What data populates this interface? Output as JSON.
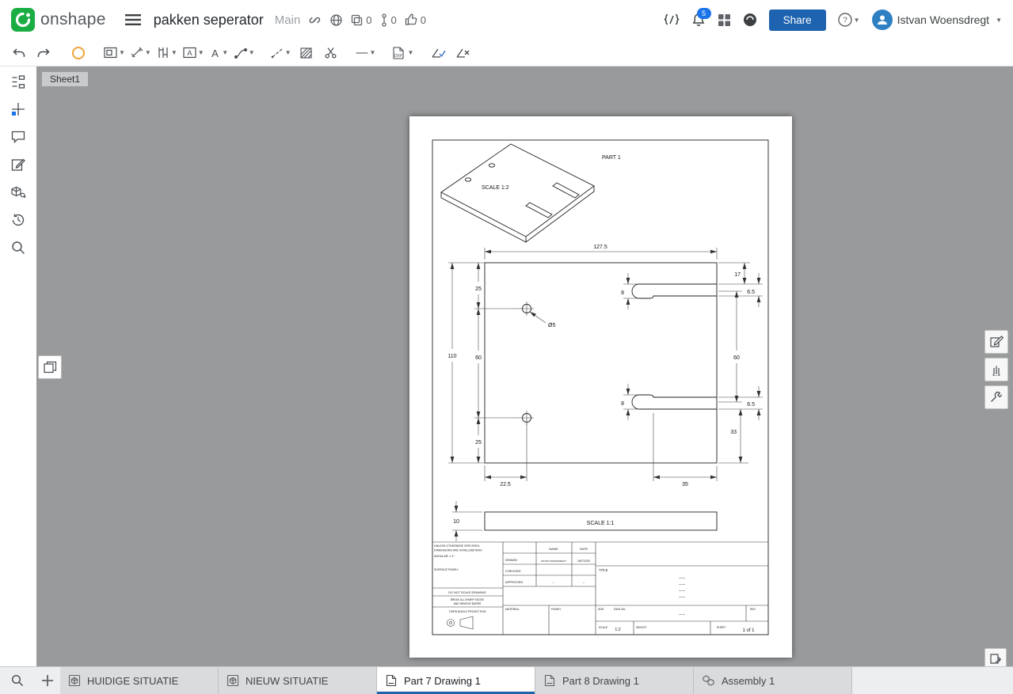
{
  "header": {
    "app_name": "onshape",
    "document_title": "pakken seperator",
    "branch": "Main",
    "copies_count": "0",
    "versions_count": "0",
    "likes_count": "0",
    "notifications_count": "5",
    "share_label": "Share",
    "user_name": "Istvan Woensdregt"
  },
  "toolbar": {
    "dxf_label": "DXF"
  },
  "canvas": {
    "sheet_tab_label": "Sheet1"
  },
  "drawing": {
    "part_label": "PART 1",
    "iso_scale": "SCALE 1:2",
    "front_scale": "SCALE 1:1",
    "dims": {
      "overall_width": "127.5",
      "top_offset": "25",
      "overall_height": "110",
      "hole_spacing": "60",
      "bottom_offset": "25",
      "hole_diameter": "Ø5",
      "slot_top_distance": "17",
      "slot_width_top": "6.5",
      "hook_width_top": "8",
      "slot_spacing": "60",
      "hook_width_bottom": "8",
      "slot_width_bottom": "6.5",
      "slot_bottom_distance": "33",
      "slot_depth": "35",
      "hole_x_offset": "22.5",
      "thickness": "10"
    },
    "titleblock": {
      "note1": "UNLESS OTHERWISE SPECIFIED:",
      "note2": "DIMENSIONS ARE IN MILLIMETERS",
      "note3": "ANGULAR: ± 1°",
      "note4": "SURFACE FINISH:",
      "do_not_scale": "DO NOT SCALE DRAWING",
      "break1": "BREAK ALL SHARP EDGES",
      "break2": "AND REMOVE BURRS",
      "projection": "THIRD ANGLE PROJECTION",
      "name_header": "NAME",
      "date_header": "DATE",
      "drawn_label": "DRAWN",
      "drawn_name": "ISTVAN WOENSDREGT",
      "drawn_date": "18/07/2025",
      "checked_label": "CHECKED",
      "approved_label": "APPROVED",
      "approved_name": "–",
      "approved_date": "–",
      "material_label": "MATERIAL",
      "finish_label": "FINISH",
      "title_label": "TITLE",
      "title_dashes": "-----",
      "size_label": "SIZE",
      "dwg_label": "DWG NO.",
      "dwg_value": "-----",
      "rev_label": "REV",
      "scale_label": "SCALE",
      "scale_value": "1:2",
      "weight_label": "WEIGHT",
      "sheet_label": "SHEET",
      "sheet_value": "1 of 1"
    }
  },
  "tabs": [
    {
      "label": "HUIDIGE SITUATIE",
      "type": "partstudio"
    },
    {
      "label": "NIEUW SITUATIE",
      "type": "partstudio"
    },
    {
      "label": "Part 7 Drawing 1",
      "type": "drawing",
      "active": true
    },
    {
      "label": "Part 8 Drawing 1",
      "type": "drawing"
    },
    {
      "label": "Assembly 1",
      "type": "assembly"
    }
  ],
  "colors": {
    "logo_green": "#19ad43",
    "share_blue": "#1e63b0",
    "badge_blue": "#1a73e8",
    "canvas_gray": "#989a9c",
    "active_tab_underline": "#1e62a8",
    "update_ring_orange": "#f2a33c"
  }
}
